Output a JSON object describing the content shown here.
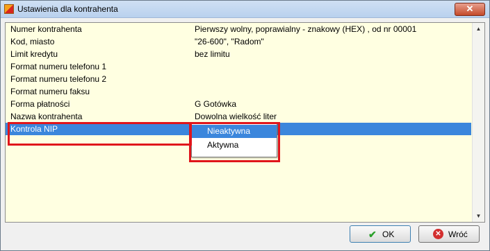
{
  "window": {
    "title": "Ustawienia dla kontrahenta",
    "close_symbol": "✕"
  },
  "settings": [
    {
      "label": "Numer kontrahenta",
      "value": "Pierwszy wolny, poprawialny - znakowy (HEX) , od nr 00001"
    },
    {
      "label": "Kod, miasto",
      "value": "\"26-600\", \"Radom\""
    },
    {
      "label": "Limit kredytu",
      "value": "bez limitu"
    },
    {
      "label": "Format numeru telefonu 1",
      "value": ""
    },
    {
      "label": "Format numeru telefonu 2",
      "value": ""
    },
    {
      "label": "Format numeru faksu",
      "value": ""
    },
    {
      "label": "Forma płatności",
      "value": "G  Gotówka"
    },
    {
      "label": "Nazwa kontrahenta",
      "value": "Dowolna wielkość liter"
    },
    {
      "label": "Kontrola NIP",
      "value": ""
    }
  ],
  "dropdown": {
    "options": [
      "Nieaktywna",
      "Aktywna"
    ],
    "selected": "Nieaktywna"
  },
  "buttons": {
    "ok": "OK",
    "back": "Wróć"
  },
  "colors": {
    "selection": "#3b86dc",
    "panel_bg": "#ffffe1",
    "highlight": "#e0151b"
  }
}
